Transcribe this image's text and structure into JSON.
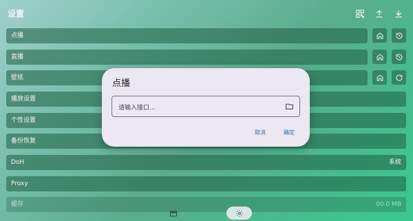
{
  "header": {
    "title": "设置"
  },
  "rows": {
    "vod": {
      "label": "点播"
    },
    "live": {
      "label": "直播"
    },
    "wallpaper": {
      "label": "壁纸"
    },
    "playback": {
      "label": "播放设置"
    },
    "personal": {
      "label": "个性设置"
    },
    "backup": {
      "label": "备份恢复"
    },
    "doh": {
      "label": "DoH",
      "value": "系统"
    },
    "proxy": {
      "label": "Proxy"
    },
    "cache": {
      "label": "缓存",
      "value": "00.0 MB"
    }
  },
  "dialog": {
    "title": "点播",
    "input_placeholder": "请输入接口...",
    "cancel": "取消",
    "confirm": "确定"
  },
  "icons": {
    "top": [
      "qr-code-icon",
      "upload-icon",
      "download-icon"
    ],
    "home": "home-icon",
    "history": "history-icon",
    "refresh": "refresh-icon",
    "folder": "folder-icon",
    "film": "film-icon",
    "settings": "gear-icon"
  },
  "colors": {
    "accent": "#3a6fa8",
    "dialog_bg": "#ece7f1",
    "row_bg": "#2a6d4f"
  }
}
